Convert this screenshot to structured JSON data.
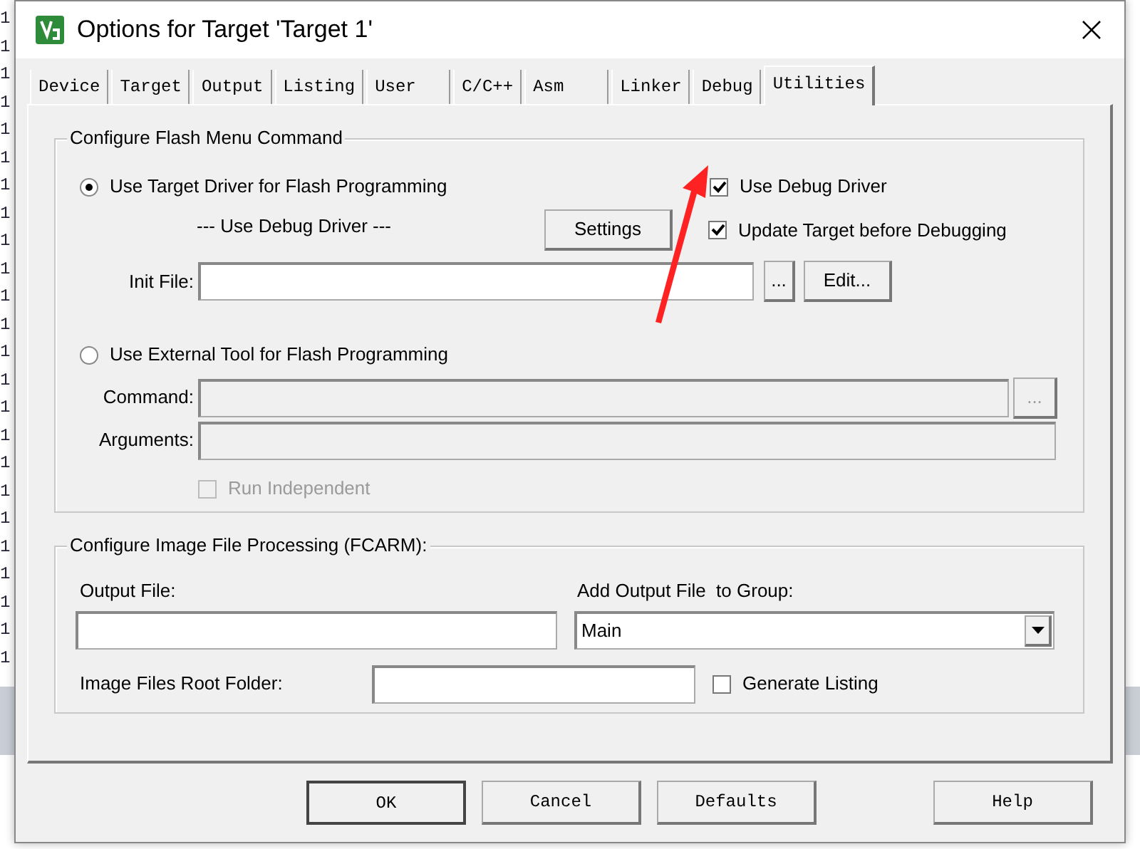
{
  "editor_behind": {
    "line_numbers": [
      "1",
      "1",
      "1",
      "1",
      "1",
      "1",
      "1",
      "1",
      "1",
      "1",
      "1",
      "1",
      "1",
      "1",
      "1",
      "1",
      "1",
      "1",
      "1",
      "1",
      "1",
      "1",
      "1",
      "1"
    ]
  },
  "window": {
    "title": "Options for Target 'Target 1'"
  },
  "tabs": [
    {
      "label": "Device",
      "selected": false
    },
    {
      "label": "Target",
      "selected": false
    },
    {
      "label": "Output",
      "selected": false
    },
    {
      "label": "Listing",
      "selected": false
    },
    {
      "label": "User",
      "selected": false
    },
    {
      "label": "C/C++",
      "selected": false
    },
    {
      "label": "Asm",
      "selected": false
    },
    {
      "label": "Linker",
      "selected": false
    },
    {
      "label": "Debug",
      "selected": false
    },
    {
      "label": "Utilities",
      "selected": true
    }
  ],
  "flash_group": {
    "title": "Configure Flash Menu Command",
    "target_driver_radio": {
      "label": "Use Target Driver for Flash Programming",
      "selected": true
    },
    "driver_note": "--- Use Debug Driver ---",
    "settings_button": "Settings",
    "use_debug_driver": {
      "label": "Use Debug Driver",
      "checked": true
    },
    "update_target": {
      "label": "Update Target before Debugging",
      "checked": true
    },
    "init_file": {
      "label": "Init File:",
      "browse": "...",
      "edit": "Edit..."
    },
    "external_tool_radio": {
      "label": "Use External Tool for Flash Programming",
      "selected": false
    },
    "command": {
      "label": "Command:",
      "disabled": true,
      "browse": "..."
    },
    "arguments": {
      "label": "Arguments:",
      "disabled": true
    },
    "run_independent": {
      "label": "Run Independent",
      "checked": false,
      "disabled": true
    }
  },
  "image_group": {
    "title": "Configure Image File Processing (FCARM):",
    "output_file": {
      "label": "Output File:"
    },
    "add_to_group": {
      "label": "Add Output File  to Group:",
      "value": "Main"
    },
    "root_folder": {
      "label": "Image Files Root Folder:"
    },
    "generate_listing": {
      "label": "Generate Listing",
      "checked": false
    }
  },
  "buttons": [
    {
      "label": "OK",
      "kind": "default"
    },
    {
      "label": "Cancel",
      "kind": "normal"
    },
    {
      "label": "Defaults",
      "kind": "normal"
    },
    {
      "label": "Help",
      "kind": "help"
    }
  ]
}
